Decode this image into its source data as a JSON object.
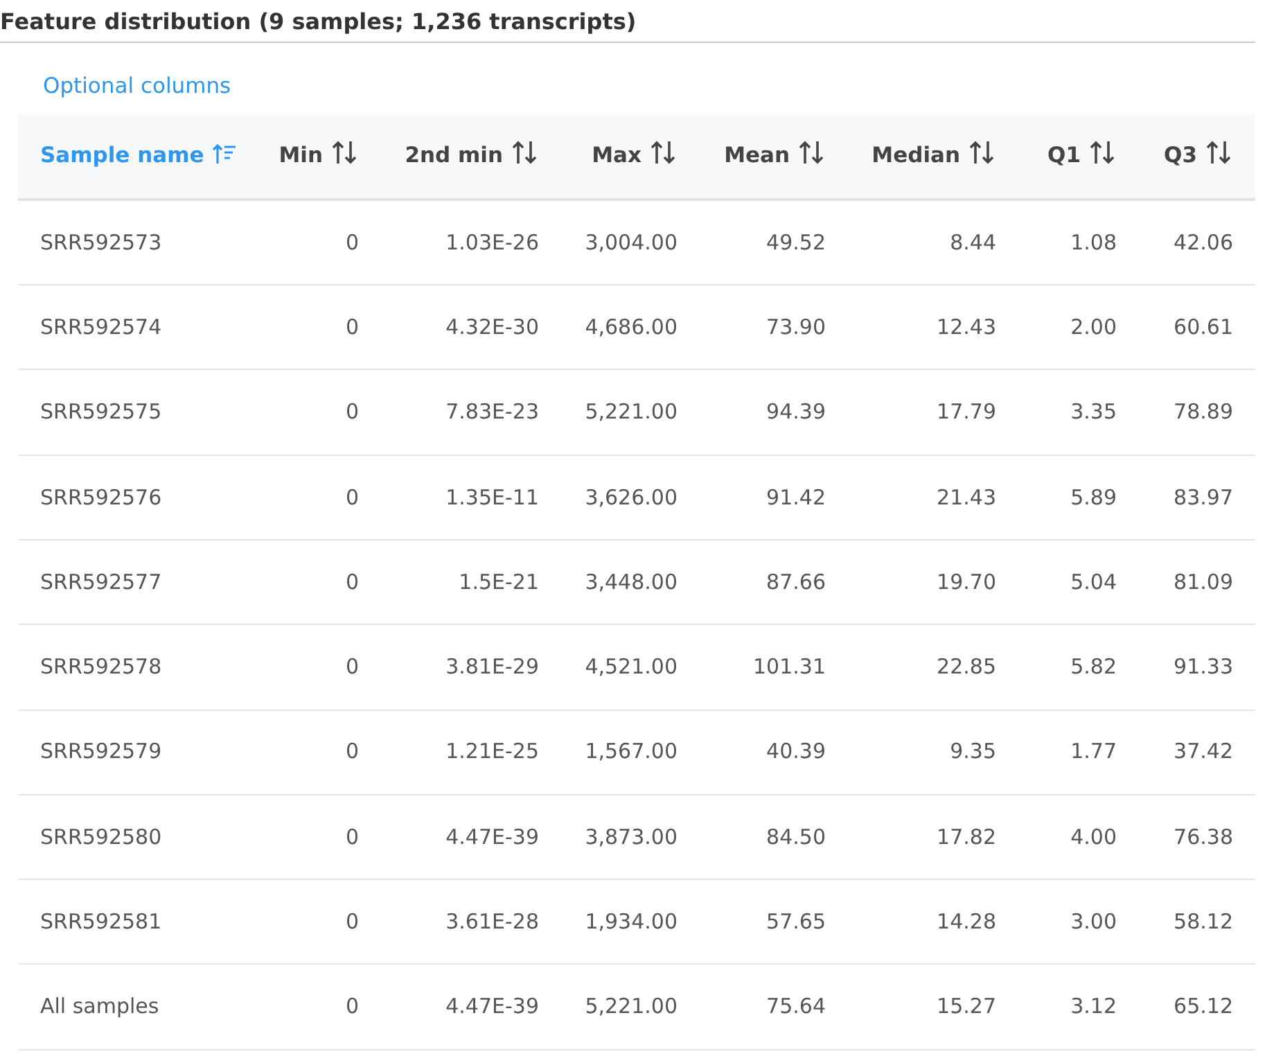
{
  "title": "Feature distribution (9 samples; 1,236 transcripts)",
  "optional_columns_link": "Optional columns",
  "table": {
    "columns": [
      {
        "label": "Sample name",
        "sorted": true
      },
      {
        "label": "Min",
        "sorted": false
      },
      {
        "label": "2nd min",
        "sorted": false
      },
      {
        "label": "Max",
        "sorted": false
      },
      {
        "label": "Mean",
        "sorted": false
      },
      {
        "label": "Median",
        "sorted": false
      },
      {
        "label": "Q1",
        "sorted": false
      },
      {
        "label": "Q3",
        "sorted": false
      }
    ],
    "rows": [
      [
        "SRR592573",
        "0",
        "1.03E-26",
        "3,004.00",
        "49.52",
        "8.44",
        "1.08",
        "42.06"
      ],
      [
        "SRR592574",
        "0",
        "4.32E-30",
        "4,686.00",
        "73.90",
        "12.43",
        "2.00",
        "60.61"
      ],
      [
        "SRR592575",
        "0",
        "7.83E-23",
        "5,221.00",
        "94.39",
        "17.79",
        "3.35",
        "78.89"
      ],
      [
        "SRR592576",
        "0",
        "1.35E-11",
        "3,626.00",
        "91.42",
        "21.43",
        "5.89",
        "83.97"
      ],
      [
        "SRR592577",
        "0",
        "1.5E-21",
        "3,448.00",
        "87.66",
        "19.70",
        "5.04",
        "81.09"
      ],
      [
        "SRR592578",
        "0",
        "3.81E-29",
        "4,521.00",
        "101.31",
        "22.85",
        "5.82",
        "91.33"
      ],
      [
        "SRR592579",
        "0",
        "1.21E-25",
        "1,567.00",
        "40.39",
        "9.35",
        "1.77",
        "37.42"
      ],
      [
        "SRR592580",
        "0",
        "4.47E-39",
        "3,873.00",
        "84.50",
        "17.82",
        "4.00",
        "76.38"
      ],
      [
        "SRR592581",
        "0",
        "3.61E-28",
        "1,934.00",
        "57.65",
        "14.28",
        "3.00",
        "58.12"
      ],
      [
        "All samples",
        "0",
        "4.47E-39",
        "5,221.00",
        "75.64",
        "15.27",
        "3.12",
        "65.12"
      ]
    ]
  }
}
